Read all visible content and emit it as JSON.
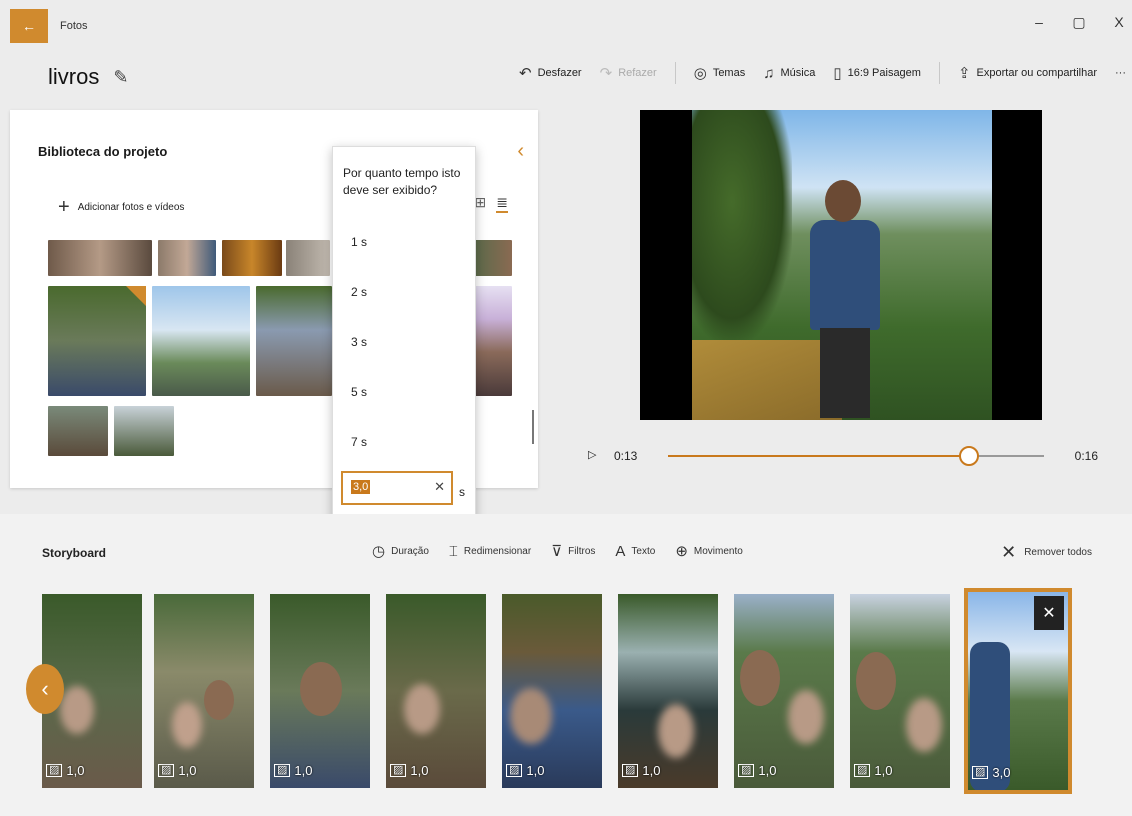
{
  "titlebar": {
    "app_title": "Fotos",
    "back": "←",
    "minimize": "–",
    "maximize": "▢",
    "close": "X"
  },
  "toolbar": {
    "project_name": "livros",
    "undo": "Desfazer",
    "redo": "Refazer",
    "themes": "Temas",
    "music": "Música",
    "aspect": "16:9 Paisagem",
    "export": "Exportar ou compartilhar",
    "more": "···"
  },
  "library": {
    "title": "Biblioteca do projeto",
    "add_label": "Adicionar fotos e vídeos"
  },
  "duration_popup": {
    "question": "Por quanto tempo isto deve ser exibido?",
    "options": [
      "1 s",
      "2 s",
      "3 s",
      "5 s",
      "7 s"
    ],
    "input_value": "3,0",
    "unit": "s"
  },
  "player": {
    "current_time": "0:13",
    "total_time": "0:16",
    "progress": 0.8
  },
  "storyboard": {
    "title": "Storyboard",
    "tools": {
      "duration": "Duração",
      "resize": "Redimensionar",
      "filters": "Filtros",
      "text": "Texto",
      "motion": "Movimento"
    },
    "remove_all": "Remover todos",
    "clips": [
      {
        "duration": "1,0"
      },
      {
        "duration": "1,0"
      },
      {
        "duration": "1,0"
      },
      {
        "duration": "1,0"
      },
      {
        "duration": "1,0"
      },
      {
        "duration": "1,0"
      },
      {
        "duration": "1,0"
      },
      {
        "duration": "1,0"
      },
      {
        "duration": "3,0"
      }
    ]
  },
  "colors": {
    "accent": "#d08a2e",
    "accent_dark": "#c9791c"
  }
}
